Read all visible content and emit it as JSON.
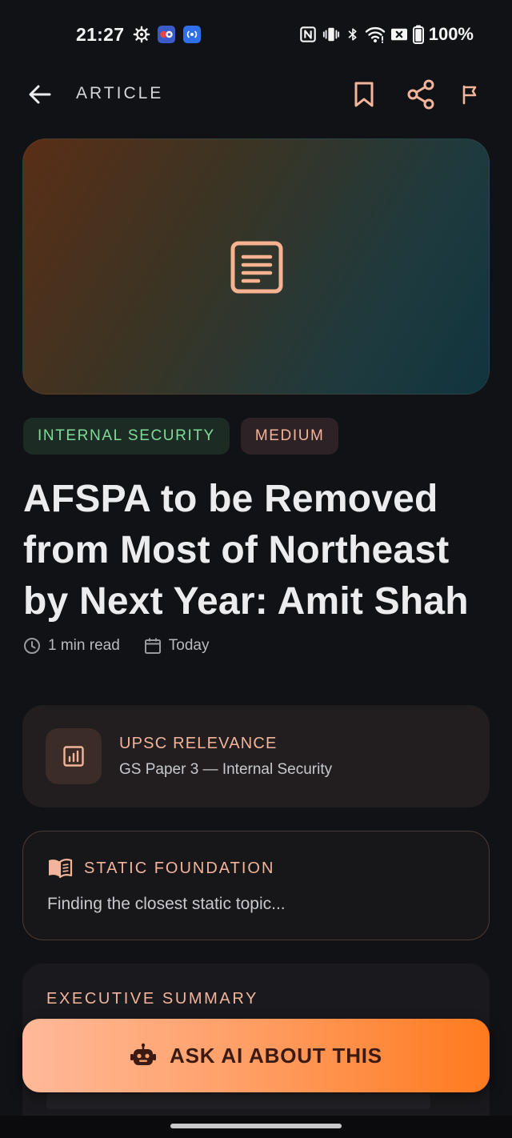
{
  "status_bar": {
    "time": "21:27",
    "battery": "100%",
    "left_icons": [
      "settings-gear-icon",
      "app-notification-icon",
      "hotspot-icon"
    ],
    "right_icons": [
      "nfc-icon",
      "vibrate-icon",
      "bluetooth-icon",
      "wifi-icon",
      "sim-off-icon",
      "battery-icon"
    ]
  },
  "app_bar": {
    "title": "ARTICLE",
    "actions": [
      "bookmark-icon",
      "share-icon",
      "flag-icon"
    ]
  },
  "hero": {
    "icon": "article-icon",
    "gradient_colors": [
      "#5A2E16",
      "#11343E"
    ]
  },
  "tags": {
    "topic": "INTERNAL SECURITY",
    "level": "MEDIUM"
  },
  "article": {
    "headline": "AFSPA to be Removed from Most of Northeast by Next Year: Amit Shah",
    "read_time": "1 min read",
    "date": "Today"
  },
  "upsc": {
    "title": "UPSC RELEVANCE",
    "subtitle": "GS Paper 3 — Internal Security"
  },
  "static_foundation": {
    "title": "STATIC FOUNDATION",
    "body": "Finding the closest static topic..."
  },
  "executive_summary": {
    "title": "EXECUTIVE SUMMARY"
  },
  "cta": {
    "label": "ASK AI ABOUT THIS"
  },
  "colors": {
    "accent": "#F2B49A",
    "tag_green": "#7FDC98",
    "cta_start": "#FFB999",
    "cta_end": "#FF7A1E",
    "background": "#111216"
  }
}
